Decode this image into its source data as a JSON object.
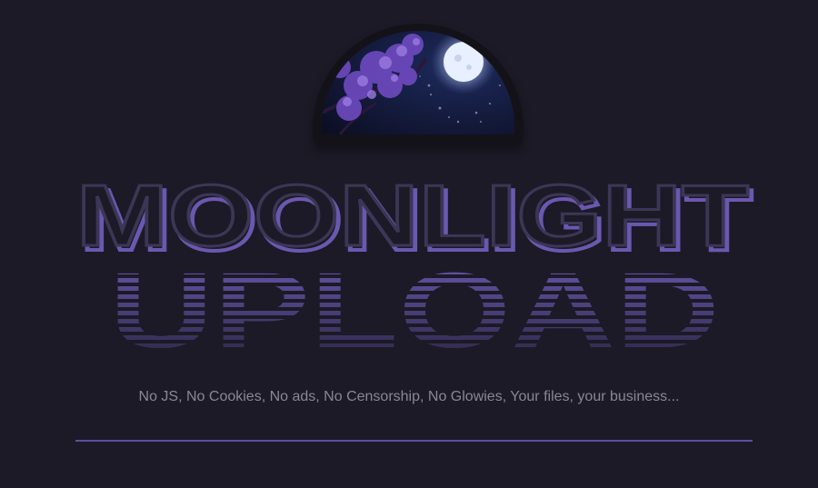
{
  "logo": {
    "icon": "moon-night-sky-logo"
  },
  "title": {
    "line1": "MOONLIGHT",
    "line2": "UPLOAD"
  },
  "tagline": "No JS, No Cookies, No ads, No Censorship, No Glowies, Your files, your business...",
  "colors": {
    "background": "#1c1a26",
    "accent": "#6a58b0",
    "text_muted": "#8a8794"
  }
}
